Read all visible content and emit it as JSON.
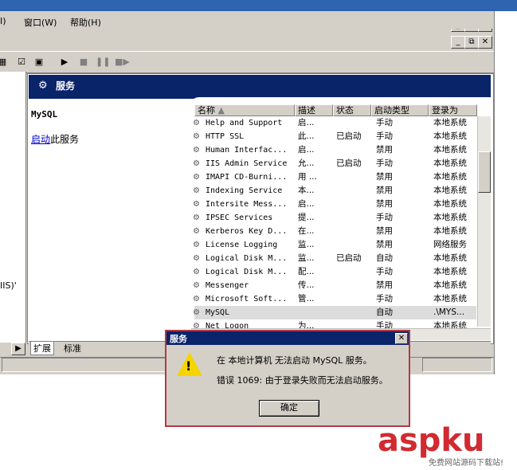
{
  "menu": {
    "view_label": "I)",
    "window_label": "窗口(W)",
    "help_label": "帮助(H)"
  },
  "header": {
    "title": "服务"
  },
  "detail": {
    "service_name": "MySQL",
    "action_link": "启动",
    "action_suffix": "此服务"
  },
  "left_cut_text": "IIS)'",
  "columns": [
    "名称",
    "描述",
    "状态",
    "启动类型",
    "登录为"
  ],
  "services": [
    {
      "name": "Help and Support",
      "desc": "启...",
      "status": "",
      "startup": "手动",
      "logon": "本地系统"
    },
    {
      "name": "HTTP SSL",
      "desc": "此...",
      "status": "已启动",
      "startup": "手动",
      "logon": "本地系统"
    },
    {
      "name": "Human Interfac...",
      "desc": "启...",
      "status": "",
      "startup": "禁用",
      "logon": "本地系统"
    },
    {
      "name": "IIS Admin Service",
      "desc": "允...",
      "status": "已启动",
      "startup": "手动",
      "logon": "本地系统"
    },
    {
      "name": "IMAPI CD-Burni...",
      "desc": "用 ...",
      "status": "",
      "startup": "禁用",
      "logon": "本地系统"
    },
    {
      "name": "Indexing Service",
      "desc": "本...",
      "status": "",
      "startup": "禁用",
      "logon": "本地系统"
    },
    {
      "name": "Intersite Mess...",
      "desc": "启...",
      "status": "",
      "startup": "禁用",
      "logon": "本地系统"
    },
    {
      "name": "IPSEC Services",
      "desc": "提...",
      "status": "",
      "startup": "手动",
      "logon": "本地系统"
    },
    {
      "name": "Kerberos Key D...",
      "desc": "在...",
      "status": "",
      "startup": "禁用",
      "logon": "本地系统"
    },
    {
      "name": "License Logging",
      "desc": "监...",
      "status": "",
      "startup": "禁用",
      "logon": "网络服务"
    },
    {
      "name": "Logical Disk M...",
      "desc": "监...",
      "status": "已启动",
      "startup": "自动",
      "logon": "本地系统"
    },
    {
      "name": "Logical Disk M...",
      "desc": "配...",
      "status": "",
      "startup": "手动",
      "logon": "本地系统"
    },
    {
      "name": "Messenger",
      "desc": "传...",
      "status": "",
      "startup": "禁用",
      "logon": "本地系统"
    },
    {
      "name": "Microsoft Soft...",
      "desc": "管...",
      "status": "",
      "startup": "手动",
      "logon": "本地系统"
    },
    {
      "name": "MySQL",
      "desc": "",
      "status": "",
      "startup": "自动",
      "logon": ".\\MYS..."
    },
    {
      "name": "Net Logon",
      "desc": "为...",
      "status": "",
      "startup": "手动",
      "logon": "本地系统"
    }
  ],
  "tabs": [
    "扩展",
    "标准"
  ],
  "dialog": {
    "title": "服务",
    "message1": "在 本地计算机 无法启动 MySQL 服务。",
    "message2": "错误 1069: 由于登录失败而无法启动服务。",
    "ok_label": "确定"
  },
  "watermark": {
    "main": "aspku",
    "sub": "免费网站源码下载站!"
  },
  "colors": {
    "header_band": "#0a246a",
    "dialog_border": "#b13a45",
    "watermark": "#d12a30"
  }
}
